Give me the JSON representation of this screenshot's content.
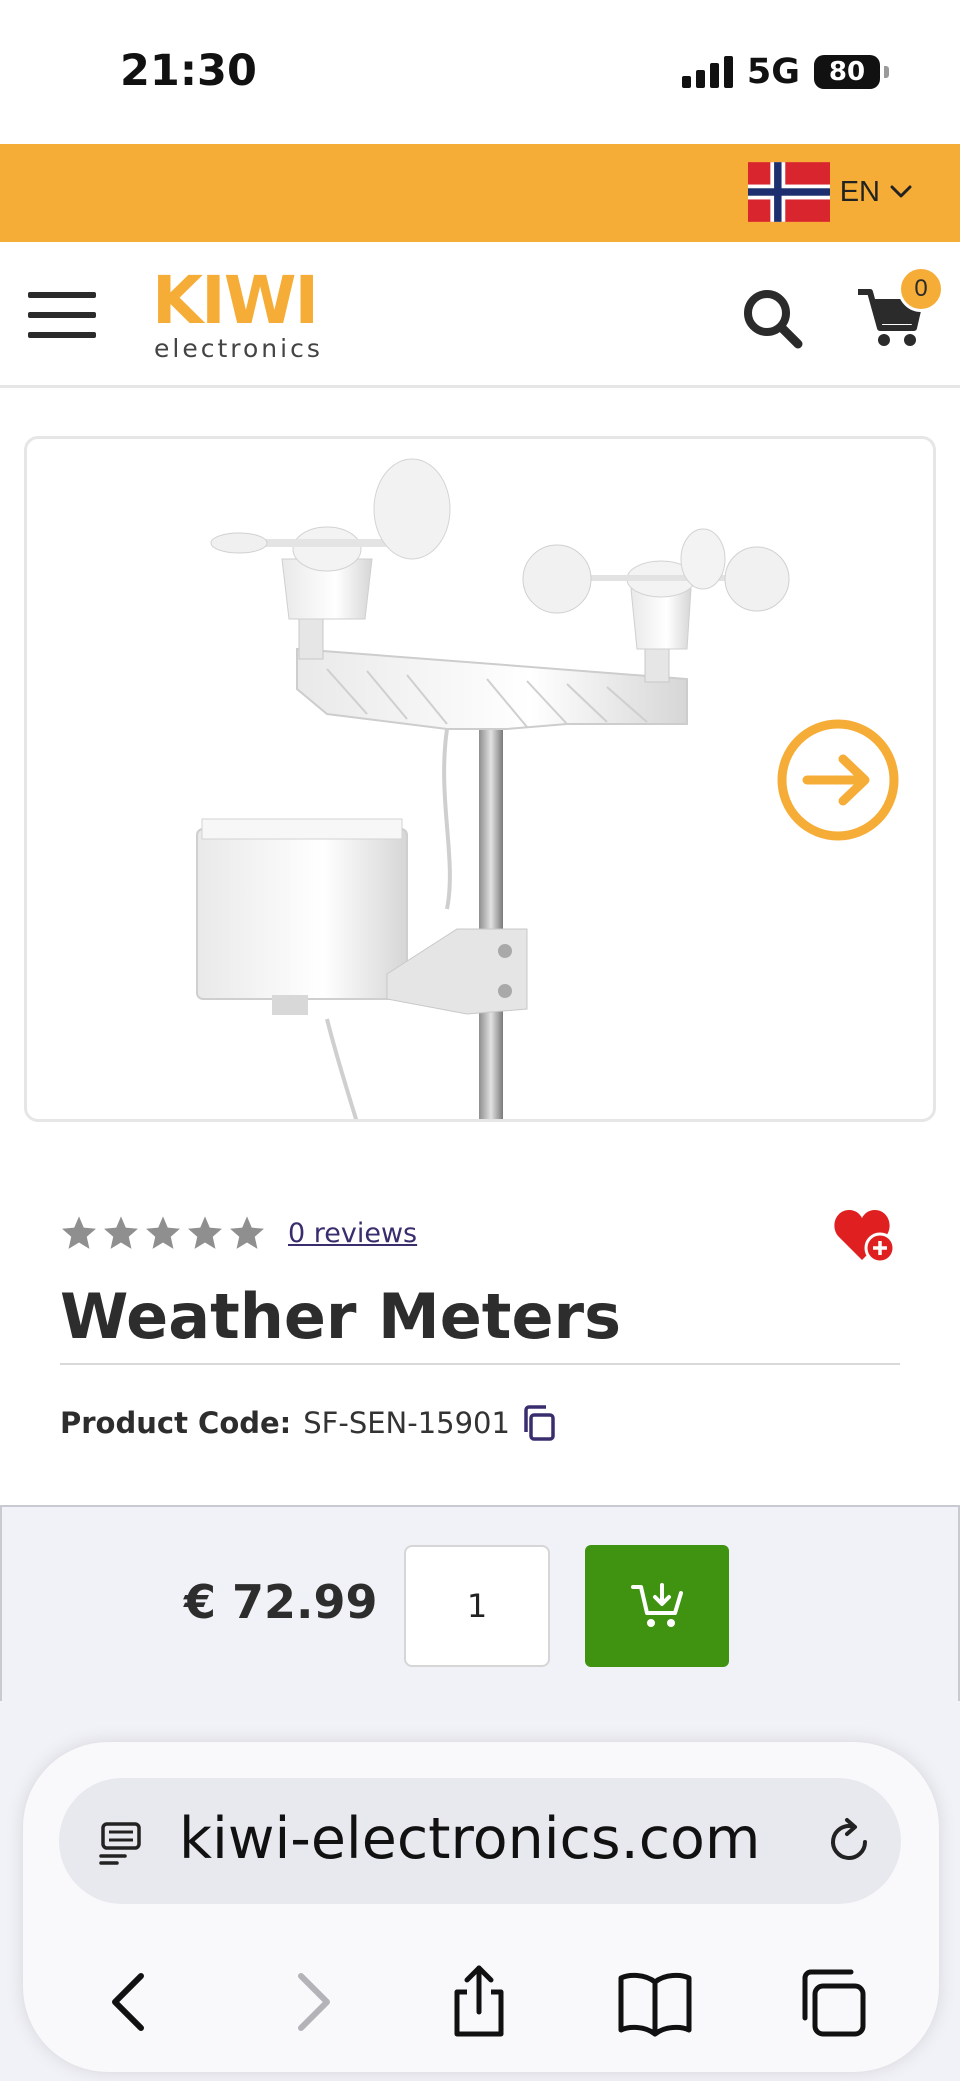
{
  "status_bar": {
    "time": "21:30",
    "network": "5G",
    "battery": "80"
  },
  "language_bar": {
    "flag": "norway-flag",
    "language": "EN",
    "colors": {
      "background": "#f6ad37"
    }
  },
  "header": {
    "logo_main": "KIWI",
    "logo_sub": "electronics",
    "cart_count": "0",
    "icons": [
      "menu-icon",
      "search-icon",
      "cart-icon"
    ]
  },
  "gallery": {
    "image": "weather-meters-photo",
    "next_icon": "arrow-right-circle-icon"
  },
  "product": {
    "rating_stars": 0,
    "rating_max": 5,
    "reviews_label": "0 reviews",
    "title": "Weather Meters",
    "code_label": "Product Code:",
    "code_value": "SF-SEN-15901"
  },
  "buy_bar": {
    "price": "€ 72.99",
    "quantity": "1",
    "button_icon": "cart-download-icon",
    "colors": {
      "button": "#3f9311"
    }
  },
  "browser": {
    "url": "kiwi-electronics.com",
    "icons": [
      "reader-icon",
      "reload-icon",
      "back-icon",
      "forward-icon",
      "share-icon",
      "bookmarks-icon",
      "tabs-icon"
    ]
  }
}
